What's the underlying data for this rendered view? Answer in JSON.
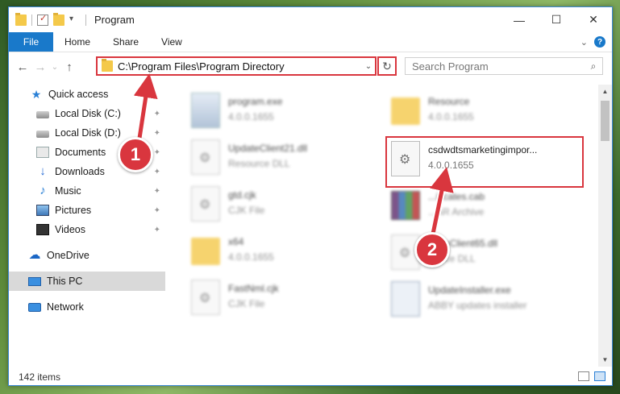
{
  "window": {
    "title": "Program",
    "controls": {
      "minimize": "—",
      "maximize": "☐",
      "close": "✕"
    }
  },
  "ribbon": {
    "tabs": [
      "File",
      "Home",
      "Share",
      "View"
    ],
    "expand_icon": "chevron-down-icon",
    "help_label": "?"
  },
  "nav": {
    "back": "←",
    "forward": "→",
    "dropdown": "⌄",
    "up": "↑"
  },
  "address": {
    "path": "C:\\Program Files\\Program Directory",
    "dropdown": "⌄",
    "refresh": "↻"
  },
  "search": {
    "placeholder": "Search Program",
    "icon": "⌕"
  },
  "sidebar": {
    "items": [
      {
        "label": "Quick access",
        "icon": "star-icon"
      },
      {
        "label": "Local Disk (C:)",
        "icon": "disk-icon",
        "pinned": true
      },
      {
        "label": "Local Disk (D:)",
        "icon": "disk-icon",
        "pinned": true
      },
      {
        "label": "Documents",
        "icon": "documents-icon",
        "pinned": true
      },
      {
        "label": "Downloads",
        "icon": "downloads-icon",
        "pinned": true
      },
      {
        "label": "Music",
        "icon": "music-icon",
        "pinned": true
      },
      {
        "label": "Pictures",
        "icon": "pictures-icon",
        "pinned": true
      },
      {
        "label": "Videos",
        "icon": "videos-icon",
        "pinned": true
      },
      {
        "label": "OneDrive",
        "icon": "onedrive-icon"
      },
      {
        "label": "This PC",
        "icon": "pc-icon",
        "selected": true
      },
      {
        "label": "Network",
        "icon": "network-icon"
      }
    ],
    "pin_glyph": "📌"
  },
  "files": [
    {
      "name": "program.exe",
      "sub": "4.0.0.1655",
      "icon": "exe-icon"
    },
    {
      "name": "Resource",
      "sub": "4.0.0.1655",
      "icon": "folder-icon"
    },
    {
      "name": "UpdateClient21.dll",
      "sub": "Resource DLL",
      "icon": "dll-icon"
    },
    {
      "name": "csdwdtsmarketingimpor...",
      "sub": "4.0.0.1655",
      "icon": "dll-icon"
    },
    {
      "name": "gtd.cjk",
      "sub": "CJK File",
      "icon": "file-icon"
    },
    {
      "name": "...ificates.cab",
      "sub": "...AR Archive",
      "icon": "rar-icon"
    },
    {
      "name": "x64",
      "sub": "4.0.0.1655",
      "icon": "folder-icon"
    },
    {
      "name": "...ateClient65.dll",
      "sub": "...urce DLL",
      "icon": "dll-icon"
    },
    {
      "name": "FastNml.cjk",
      "sub": "CJK File",
      "icon": "file-icon"
    },
    {
      "name": "UpdateInstaller.exe",
      "sub": "ABBY updates installer",
      "icon": "installer-icon"
    }
  ],
  "status": {
    "count": "142 items"
  },
  "annotations": {
    "badge1": "1",
    "badge2": "2",
    "color": "#d9363e"
  },
  "colors": {
    "accent": "#1979ca",
    "highlight": "#d9363e"
  }
}
